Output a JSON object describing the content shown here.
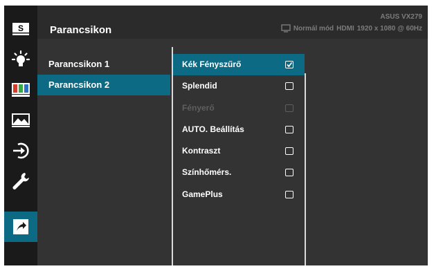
{
  "sidebar": {
    "items": [
      {
        "icon": "splendid-s-icon",
        "label": "S"
      },
      {
        "icon": "blue-light-filter-icon"
      },
      {
        "icon": "color-bars-icon"
      },
      {
        "icon": "image-icon"
      },
      {
        "icon": "input-select-icon"
      },
      {
        "icon": "system-setup-wrench-icon"
      },
      {
        "icon": "shortcut-arrow-icon",
        "active": true
      }
    ]
  },
  "header": {
    "title": "Parancsikon",
    "model": "ASUS VX279",
    "mode": "Normál mód",
    "input": "HDMI",
    "resolution": "1920 x 1080 @ 60Hz"
  },
  "shortcut_list": [
    "Parancsikon 1",
    "Parancsikon 2"
  ],
  "options": [
    {
      "label": "Kék Fényszűrő",
      "checked": true
    },
    {
      "label": "Splendid",
      "checked": false
    },
    {
      "label": "Fényerő",
      "checked": false,
      "disabled": true
    },
    {
      "label": "AUTO. Beállítás",
      "checked": false
    },
    {
      "label": "Kontraszt",
      "checked": false
    },
    {
      "label": "Színhőmérs.",
      "checked": false
    },
    {
      "label": "GamePlus",
      "checked": false
    }
  ],
  "colors": {
    "accent": "#0d6a84",
    "panel": "#333333",
    "sidebar": "#1a1a1a"
  }
}
